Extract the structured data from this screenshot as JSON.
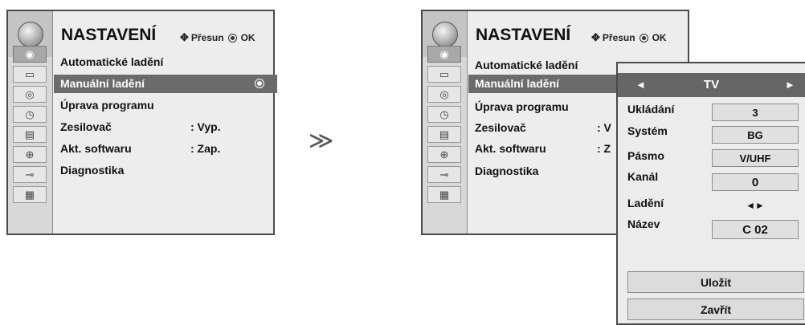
{
  "menu": {
    "title": "NASTAVENÍ",
    "nav_hint_move": "Přesun",
    "nav_hint_ok": "OK",
    "items": [
      {
        "label": "Automatické ladění",
        "value": ""
      },
      {
        "label": "Manuální ladění",
        "value": ""
      },
      {
        "label": "Úprava programu",
        "value": ""
      },
      {
        "label": "Zesilovač",
        "value": ": Vyp."
      },
      {
        "label": "Akt. softwaru",
        "value": ": Zap."
      },
      {
        "label": "Diagnostika",
        "value": ""
      }
    ],
    "selected_index": 1,
    "categories": [
      "satellite-icon",
      "screen-icon",
      "speaker-icon",
      "clock-icon",
      "options-icon",
      "lock-icon",
      "input-plug-icon",
      "clapperboard-icon"
    ]
  },
  "right_menu": {
    "truncated_values": [
      ": V",
      ": Z"
    ]
  },
  "separator": "≫",
  "manual_tuning": {
    "header": "TV",
    "fields": [
      {
        "label": "Ukládání",
        "value": "3"
      },
      {
        "label": "Systém",
        "value": "BG"
      },
      {
        "label": "Pásmo",
        "value": "V/UHF"
      },
      {
        "label": "Kanál",
        "value": "0"
      },
      {
        "label": "Ladění",
        "value": "◄►"
      },
      {
        "label": "Název",
        "value": "C  02"
      }
    ],
    "buttons": {
      "save": "Uložit",
      "close": "Zavřít"
    }
  },
  "colors": {
    "selected_row": "#6b6b6b",
    "panel_bg": "#ededed",
    "icon_column": "#d8d8d8"
  }
}
